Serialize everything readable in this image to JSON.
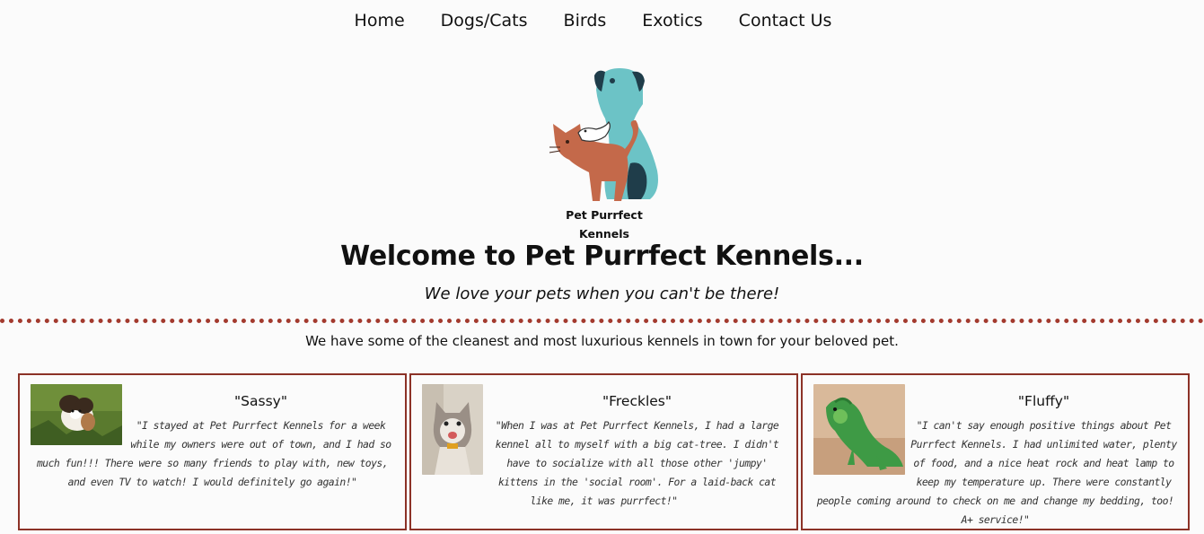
{
  "nav": {
    "items": [
      {
        "label": "Home"
      },
      {
        "label": "Dogs/Cats"
      },
      {
        "label": "Birds"
      },
      {
        "label": "Exotics"
      },
      {
        "label": "Contact Us"
      }
    ]
  },
  "logo": {
    "line1": "Pet Purrfect",
    "line2": "Kennels"
  },
  "hero": {
    "welcome": "Welcome to Pet Purrfect Kennels...",
    "tagline": "We love your pets when you can't be there!",
    "intro": "We have some of the cleanest and most luxurious kennels in town for your beloved pet."
  },
  "colors": {
    "accent": "#8c3227",
    "divider": "#a33a2e",
    "dog_teal": "#6cc3c6",
    "cat_brown": "#c4694a"
  },
  "testimonials": [
    {
      "name": "\"Sassy\"",
      "quote": "\"I stayed at Pet Purrfect Kennels for a week while my owners were out of town, and I had so much fun!!! There were so many friends to play with, new toys, and even TV to watch! I would definitely go again!\"",
      "photo": "puppy-photo"
    },
    {
      "name": "\"Freckles\"",
      "quote": "\"When I was at Pet Purrfect Kennels, I had a large kennel all to myself with a big cat-tree. I didn't have to socialize with all those other 'jumpy' kittens in the 'social room'. For a laid-back cat like me, it was purrfect!\"",
      "photo": "cat-photo"
    },
    {
      "name": "\"Fluffy\"",
      "quote": "\"I can't say enough positive things about Pet Purrfect Kennels. I had unlimited water, plenty of food, and a nice heat rock and heat lamp to keep my temperature up. There were constantly people coming around to check on me and change my bedding, too! A+ service!\"",
      "photo": "iguana-photo"
    }
  ]
}
